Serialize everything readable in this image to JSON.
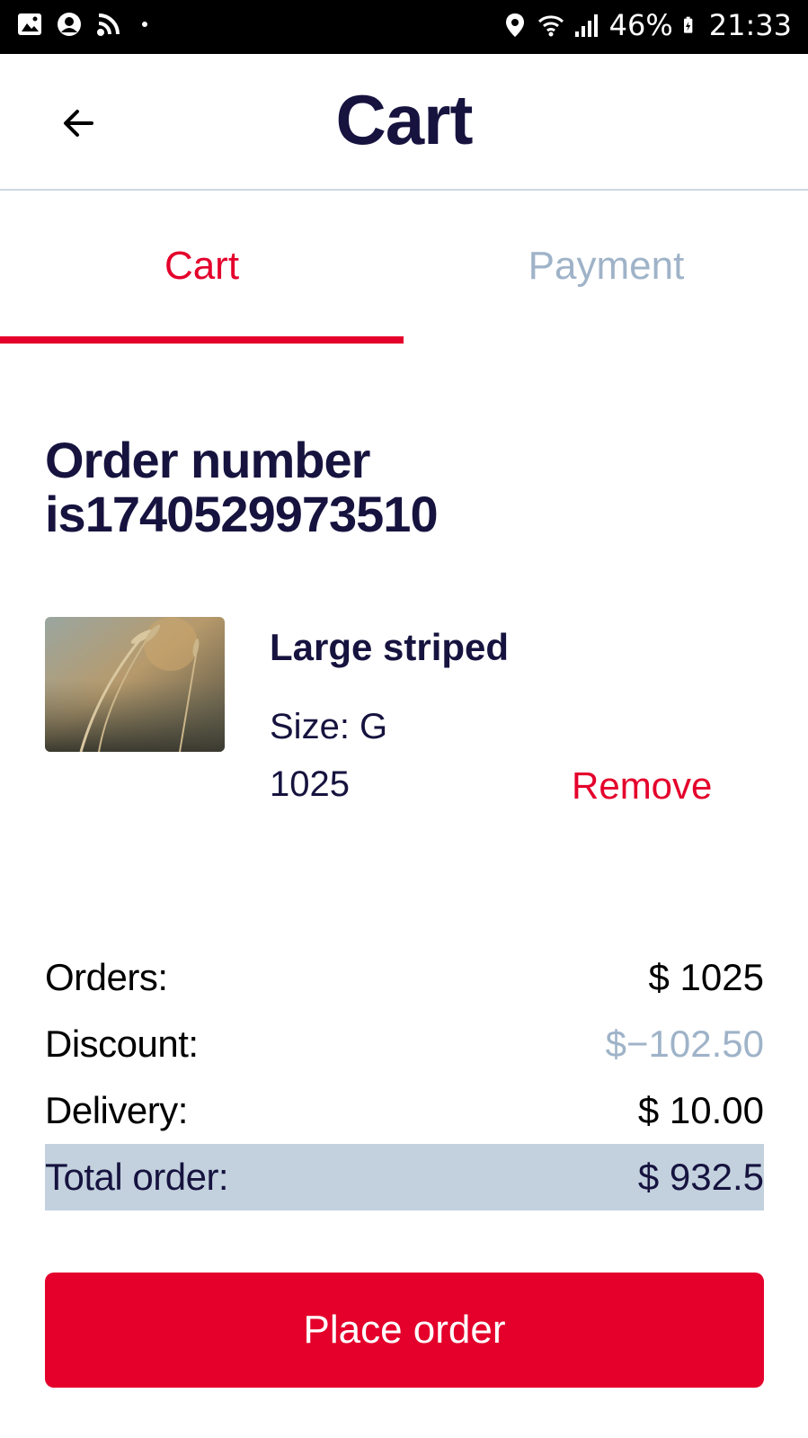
{
  "status_bar": {
    "icons_left": [
      "image-icon",
      "account-circle-icon",
      "wifi-calling-icon"
    ],
    "icons_right": [
      "location-icon",
      "wifi-icon",
      "signal-icon",
      "battery-charging-icon"
    ],
    "battery": "46%",
    "time": "21:33"
  },
  "header": {
    "title": "Cart",
    "back_icon": "arrow-left-icon"
  },
  "tabs": [
    {
      "label": "Cart",
      "active": true
    },
    {
      "label": "Payment",
      "active": false
    }
  ],
  "order": {
    "number_text": "Order number is1740529973510"
  },
  "item": {
    "name": "Large striped",
    "size": "Size: G",
    "price": "1025",
    "remove_label": "Remove",
    "image": "wheat-field-thumbnail"
  },
  "summary": {
    "orders_label": "Orders:",
    "orders_value": "$ 1025",
    "discount_label": "Discount:",
    "discount_value": "$−102.50",
    "delivery_label": "Delivery:",
    "delivery_value": "$ 10.00",
    "total_label": "Total order:",
    "total_value": "$ 932.5"
  },
  "actions": {
    "place_order_label": "Place order"
  },
  "colors": {
    "accent": "#e4002b",
    "title": "#16133f",
    "muted": "#9fb3c8",
    "total_bg": "#c3d1de"
  }
}
